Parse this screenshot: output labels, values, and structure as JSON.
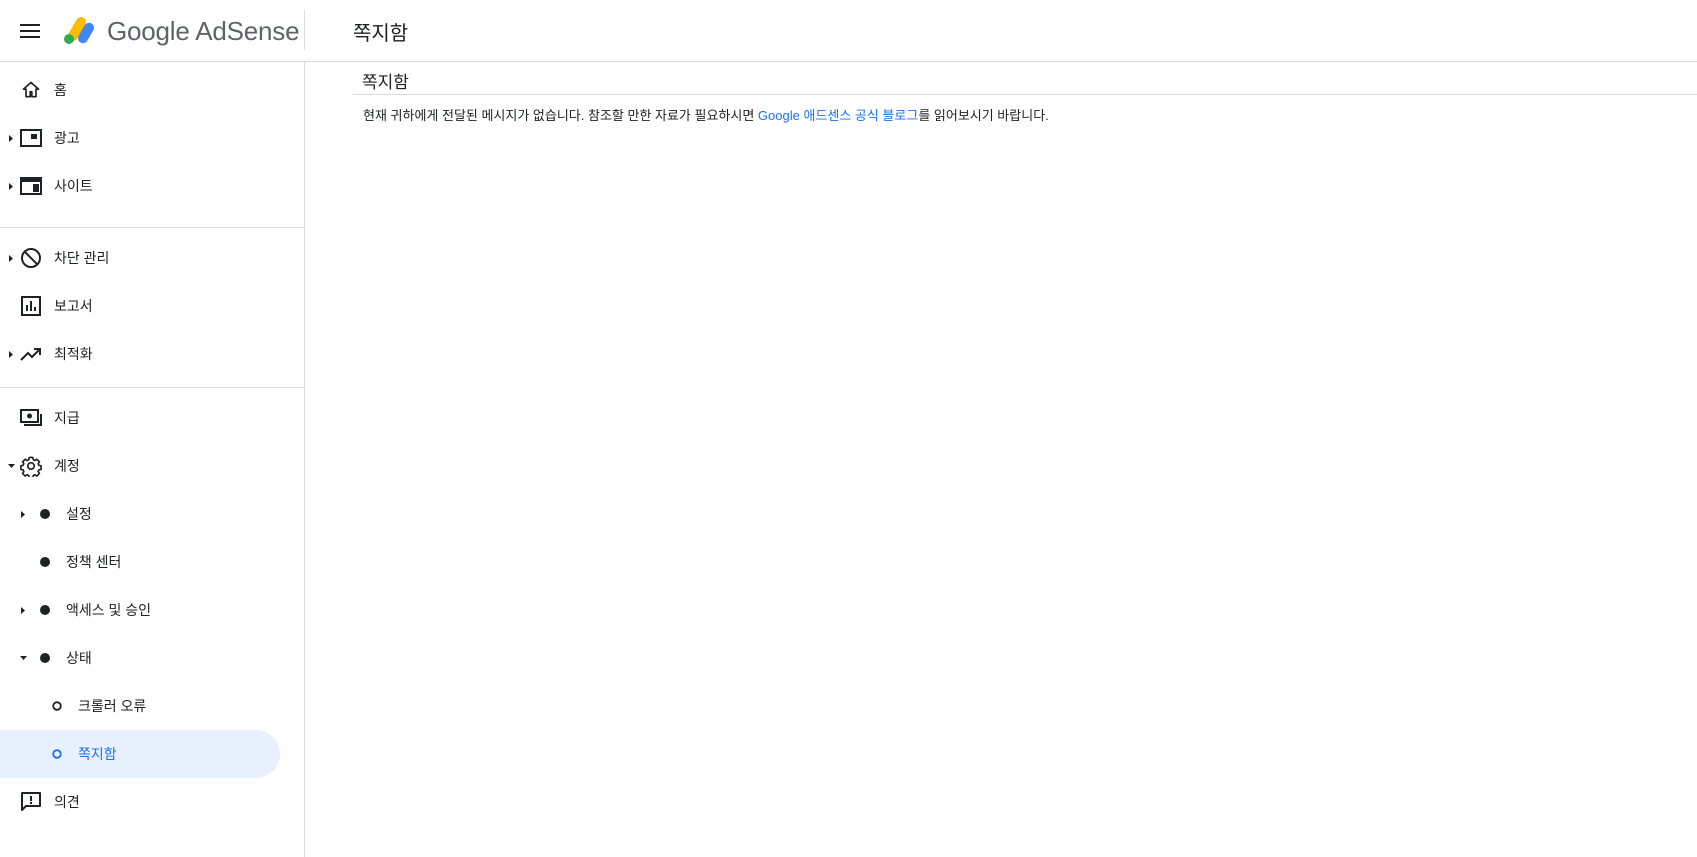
{
  "header": {
    "brand_google": "Google",
    "brand_product": "AdSense",
    "page_title": "쪽지함"
  },
  "sidebar": {
    "items": [
      {
        "label": "홈",
        "icon": "home-icon"
      },
      {
        "label": "광고",
        "icon": "ads-icon"
      },
      {
        "label": "사이트",
        "icon": "sites-icon"
      },
      {
        "label": "차단 관리",
        "icon": "block-icon"
      },
      {
        "label": "보고서",
        "icon": "reports-icon"
      },
      {
        "label": "최적화",
        "icon": "trending-up-icon"
      },
      {
        "label": "지급",
        "icon": "payments-icon"
      },
      {
        "label": "계정",
        "icon": "gear-icon"
      },
      {
        "label": "설정"
      },
      {
        "label": "정책 센터"
      },
      {
        "label": "액세스 및 승인"
      },
      {
        "label": "상태"
      },
      {
        "label": "크롤러 오류"
      },
      {
        "label": "쪽지함"
      },
      {
        "label": "의견",
        "icon": "feedback-icon"
      }
    ],
    "active_index": 13
  },
  "main": {
    "title": "쪽지함",
    "message_before": "현재 귀하에게 전달된 메시지가 없습니다. 참조할 만한 자료가 필요하시면 ",
    "message_link": "Google 애드센스 공식 블로그",
    "message_after": "를 읽어보시기 바랍니다."
  },
  "colors": {
    "accent": "#1a73e8",
    "active_bg": "#e8f0fe",
    "divider": "#dadce0",
    "text": "#202124"
  }
}
